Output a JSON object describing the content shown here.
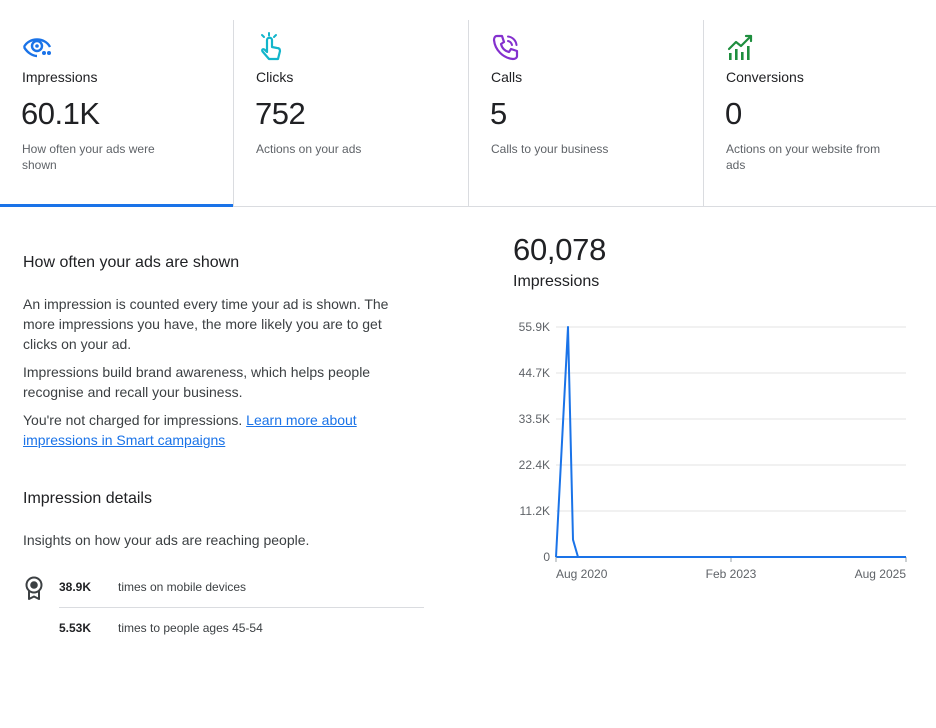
{
  "colors": {
    "accent": "#1a73e8",
    "divider": "#dadce0",
    "clicks_icon": "#12b5cb",
    "calls_icon": "#8430ce",
    "conversions_icon": "#1e8e3e"
  },
  "metrics": [
    {
      "icon": "eye-icon",
      "label": "Impressions",
      "value": "60.1K",
      "desc": "How often your ads were shown"
    },
    {
      "icon": "tap-icon",
      "label": "Clicks",
      "value": "752",
      "desc": "Actions on your ads"
    },
    {
      "icon": "phone-icon",
      "label": "Calls",
      "value": "5",
      "desc": "Calls to your business"
    },
    {
      "icon": "growth-chart-icon",
      "label": "Conversions",
      "value": "0",
      "desc": "Actions on your website from ads"
    }
  ],
  "explanation": {
    "title": "How often your ads are shown",
    "p1": "An impression is counted every time your ad is shown. The more impressions you have, the more likely you are to get clicks on your ad.",
    "p2": "Impressions build brand awareness, which helps people recognise and recall your business.",
    "p3_text": "You're not charged for impressions. ",
    "p3_link": "Learn more about impressions in Smart campaigns"
  },
  "details": {
    "title": "Impression details",
    "subtitle": "Insights on how your ads are reaching people.",
    "rows": [
      {
        "icon": "award-icon",
        "value": "38.9K",
        "text": "times on mobile devices"
      },
      {
        "icon": "",
        "value": "5.53K",
        "text": "times to people ages 45-54"
      }
    ]
  },
  "summary": {
    "total": "60,078",
    "label": "Impressions"
  },
  "chart_data": {
    "type": "line",
    "ylim": [
      0,
      55900
    ],
    "y_ticks": [
      "55.9K",
      "44.7K",
      "33.5K",
      "22.4K",
      "11.2K",
      "0"
    ],
    "x_ticks": [
      "Aug 2020",
      "Feb 2023",
      "Aug 2025"
    ],
    "series": [
      {
        "x": [
          "Jun 2020",
          "Jul 2020",
          "Aug 2020",
          "Sep 2020",
          "Oct 2020",
          "Aug 2025"
        ],
        "values": [
          0,
          55900,
          4200,
          0,
          0,
          0
        ]
      }
    ]
  }
}
